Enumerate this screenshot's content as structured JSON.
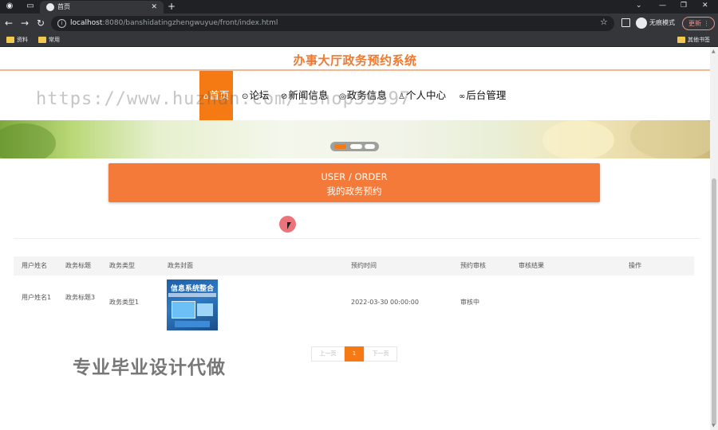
{
  "browser": {
    "tab_title": "首页",
    "url_host": "localhost",
    "url_path": ":8080/banshidatingzhengwuyue/front/index.html",
    "incognito_label": "无痕模式",
    "update_label": "更新",
    "bookmarks": [
      "资料",
      "常用"
    ],
    "other_bookmarks": "其他书签"
  },
  "site": {
    "title": "办事大厅政务预约系统",
    "watermark": "https://www.huzhan.com/ishop39397",
    "nav": [
      {
        "label": "首页",
        "icon": "home-icon"
      },
      {
        "label": "论坛",
        "icon": "forum-icon"
      },
      {
        "label": "新闻信息",
        "icon": "news-icon"
      },
      {
        "label": "政务信息",
        "icon": "info-icon"
      },
      {
        "label": "个人中心",
        "icon": "user-icon"
      },
      {
        "label": "后台管理",
        "icon": "link-icon"
      }
    ]
  },
  "section": {
    "en": "USER / ORDER",
    "cn": "我的政务预约"
  },
  "table": {
    "headers": [
      "用户姓名",
      "政务标题",
      "政务类型",
      "政务封面",
      "预约时间",
      "预约审核",
      "审核结果",
      "操作"
    ],
    "rows": [
      {
        "user_name": "用户姓名1",
        "title": "政务标题3",
        "type": "政务类型1",
        "cover_text": "信息系统整合",
        "time": "2022-03-30 00:00:00",
        "review": "审核中",
        "result": "",
        "action": ""
      }
    ]
  },
  "pager": {
    "prev": "上一页",
    "current": "1",
    "next": "下一页"
  },
  "promo": "专业毕业设计代做",
  "colors": {
    "accent": "#f57a14",
    "title": "#f0792f",
    "order_box": "#f47a3a"
  }
}
